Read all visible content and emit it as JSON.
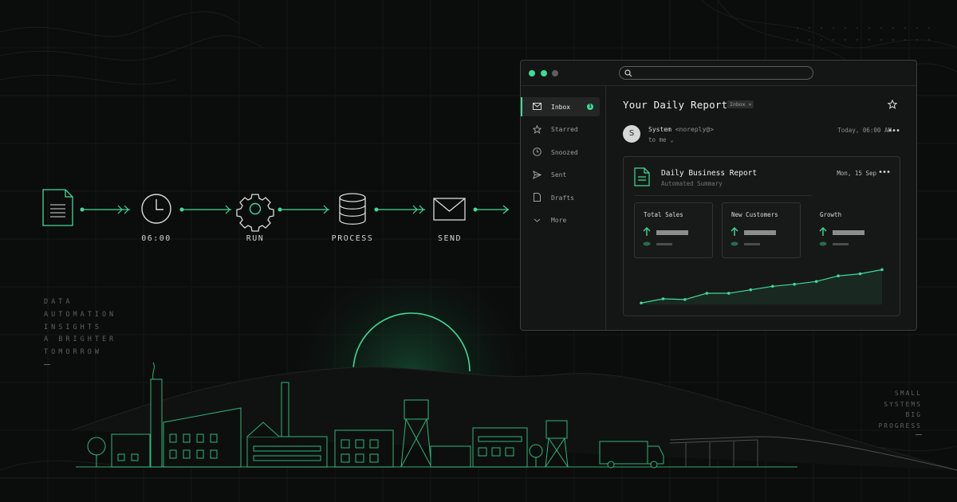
{
  "pipeline": {
    "steps": [
      {
        "label": "",
        "icon": "document-icon"
      },
      {
        "label": "06:00",
        "icon": "clock-icon"
      },
      {
        "label": "RUN",
        "icon": "gear-icon"
      },
      {
        "label": "PROCESS",
        "icon": "database-icon"
      },
      {
        "label": "SEND",
        "icon": "envelope-icon"
      }
    ]
  },
  "tagline_left": [
    "DATA",
    "AUTOMATION",
    "INSIGHTS",
    "A BRIGHTER",
    "TOMORROW"
  ],
  "tagline_right": [
    "SMALL",
    "SYSTEMS",
    "BIG",
    "PROGRESS"
  ],
  "colors": {
    "accent": "#3ddc97",
    "background": "#0b0c0c",
    "window": "#141615"
  },
  "window": {
    "search": {
      "value": "",
      "placeholder": ""
    },
    "sidebar": {
      "items": [
        {
          "label": "Inbox",
          "icon": "inbox-icon",
          "active": true,
          "badge": "1"
        },
        {
          "label": "Starred",
          "icon": "star-icon"
        },
        {
          "label": "Snoozed",
          "icon": "clock-icon"
        },
        {
          "label": "Sent",
          "icon": "send-icon"
        },
        {
          "label": "Drafts",
          "icon": "draft-icon"
        },
        {
          "label": "More",
          "icon": "chevron-down-icon"
        }
      ]
    },
    "email": {
      "subject": "Your Daily Report",
      "tag": "Inbox ×",
      "avatar_letter": "S",
      "sender_name": "System",
      "sender_address": "<noreply@>",
      "to": "to me ⌄",
      "date": "Today, 06:00 AM"
    },
    "card": {
      "title": "Daily Business Report",
      "subtitle": "Automated Summary",
      "date": "Mon, 15 Sep",
      "metrics": [
        {
          "label": "Total Sales"
        },
        {
          "label": "New Customers"
        },
        {
          "label": "Growth"
        }
      ]
    }
  },
  "chart_data": {
    "type": "line",
    "x": [
      1,
      2,
      3,
      4,
      5,
      6,
      7,
      8,
      9,
      10,
      11,
      12
    ],
    "values": [
      2,
      8,
      7,
      16,
      16,
      21,
      26,
      29,
      33,
      41,
      44,
      50
    ],
    "ylim": [
      0,
      55
    ],
    "grid": false,
    "title": "",
    "xlabel": "",
    "ylabel": ""
  }
}
